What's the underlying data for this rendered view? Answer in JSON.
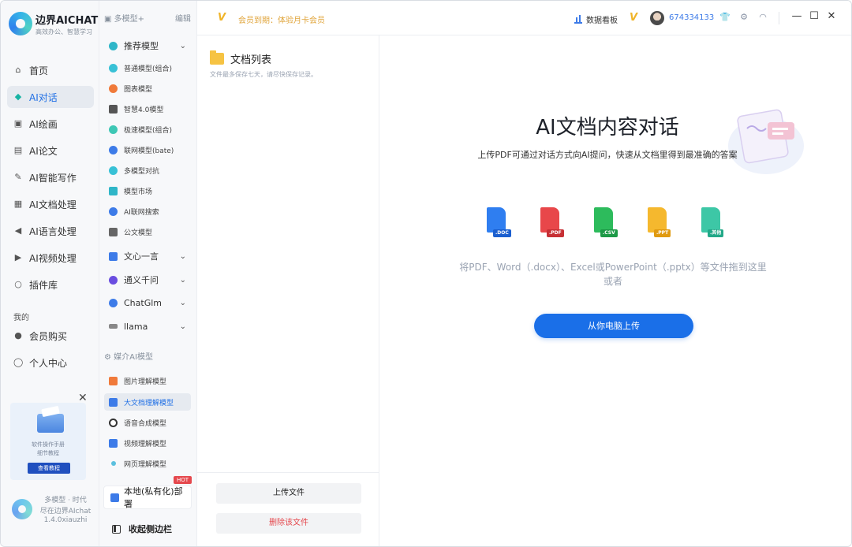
{
  "app": {
    "logo_title": "边界AICHAT",
    "logo_sub": "高效办公、智慧学习",
    "footer_lines": [
      "多模型 · 时代",
      "尽在边界AIchat",
      "1.4.0xiauzhi"
    ]
  },
  "nav": {
    "items": [
      {
        "label": "首页",
        "icon": "home-icon"
      },
      {
        "label": "AI对话",
        "icon": "cube-icon",
        "active": true
      },
      {
        "label": "AI绘画",
        "icon": "image-icon"
      },
      {
        "label": "AI论文",
        "icon": "paper-icon"
      },
      {
        "label": "AI智能写作",
        "icon": "pen-icon"
      },
      {
        "label": "AI文档处理",
        "icon": "document-icon"
      },
      {
        "label": "AI语言处理",
        "icon": "speaker-icon"
      },
      {
        "label": "AI视频处理",
        "icon": "video-icon"
      },
      {
        "label": "插件库",
        "icon": "bulb-icon"
      }
    ],
    "section_label": "我的",
    "my_items": [
      {
        "label": "会员购买",
        "icon": "user-icon"
      },
      {
        "label": "个人中心",
        "icon": "person-icon"
      }
    ]
  },
  "promo": {
    "line1": "软件操作手册",
    "line2": "细节教程",
    "button": "查看教程",
    "close": "✕"
  },
  "models": {
    "header": "多模型+",
    "edit": "编辑",
    "recommended_group": "推荐模型",
    "recommended": [
      "普通模型(组合)",
      "图表模型",
      "智慧4.0模型",
      "极速模型(组合)",
      "联网模型(bate)",
      "多模型对抗",
      "模型市场",
      "AI联网搜索",
      "公文模型"
    ],
    "groups": [
      "文心一言",
      "通义千问",
      "ChatGlm",
      "llama"
    ],
    "media_header": "媒介AI模型",
    "media": [
      "图片理解模型",
      "大文档理解模型",
      "语音合成模型",
      "视频理解模型",
      "网页理解模型"
    ],
    "local": "本地(私有化)部署",
    "hot": "HOT",
    "collapse": "收起侧边栏"
  },
  "topbar": {
    "vip_text": "会员到期：体验月卡会员",
    "dashboard": "数据看板",
    "user_id": "674334133"
  },
  "doclist": {
    "title": "文档列表",
    "note": "文件最多保存七天，请尽快保存记录。",
    "upload": "上传文件",
    "delete": "删除该文件"
  },
  "main": {
    "title": "AI文档内容对话",
    "subtitle": "上传PDF可通过对话方式向AI提问，快速从文档里得到最准确的答案",
    "file_types": [
      {
        "label": ".DOC",
        "color": "#2f7ef0"
      },
      {
        "label": ".PDF",
        "color": "#e8474a"
      },
      {
        "label": ".CSV",
        "color": "#2dbb5c"
      },
      {
        "label": ".PPT",
        "color": "#f5b82e"
      },
      {
        "label": ".其他",
        "color": "#3dc7a6"
      }
    ],
    "drop_hint_line1": "将PDF、Word（.docx）、Excel或PowerPoint（.pptx）等文件拖到这里",
    "drop_hint_line2": "或者",
    "upload_button": "从你电脑上传"
  }
}
